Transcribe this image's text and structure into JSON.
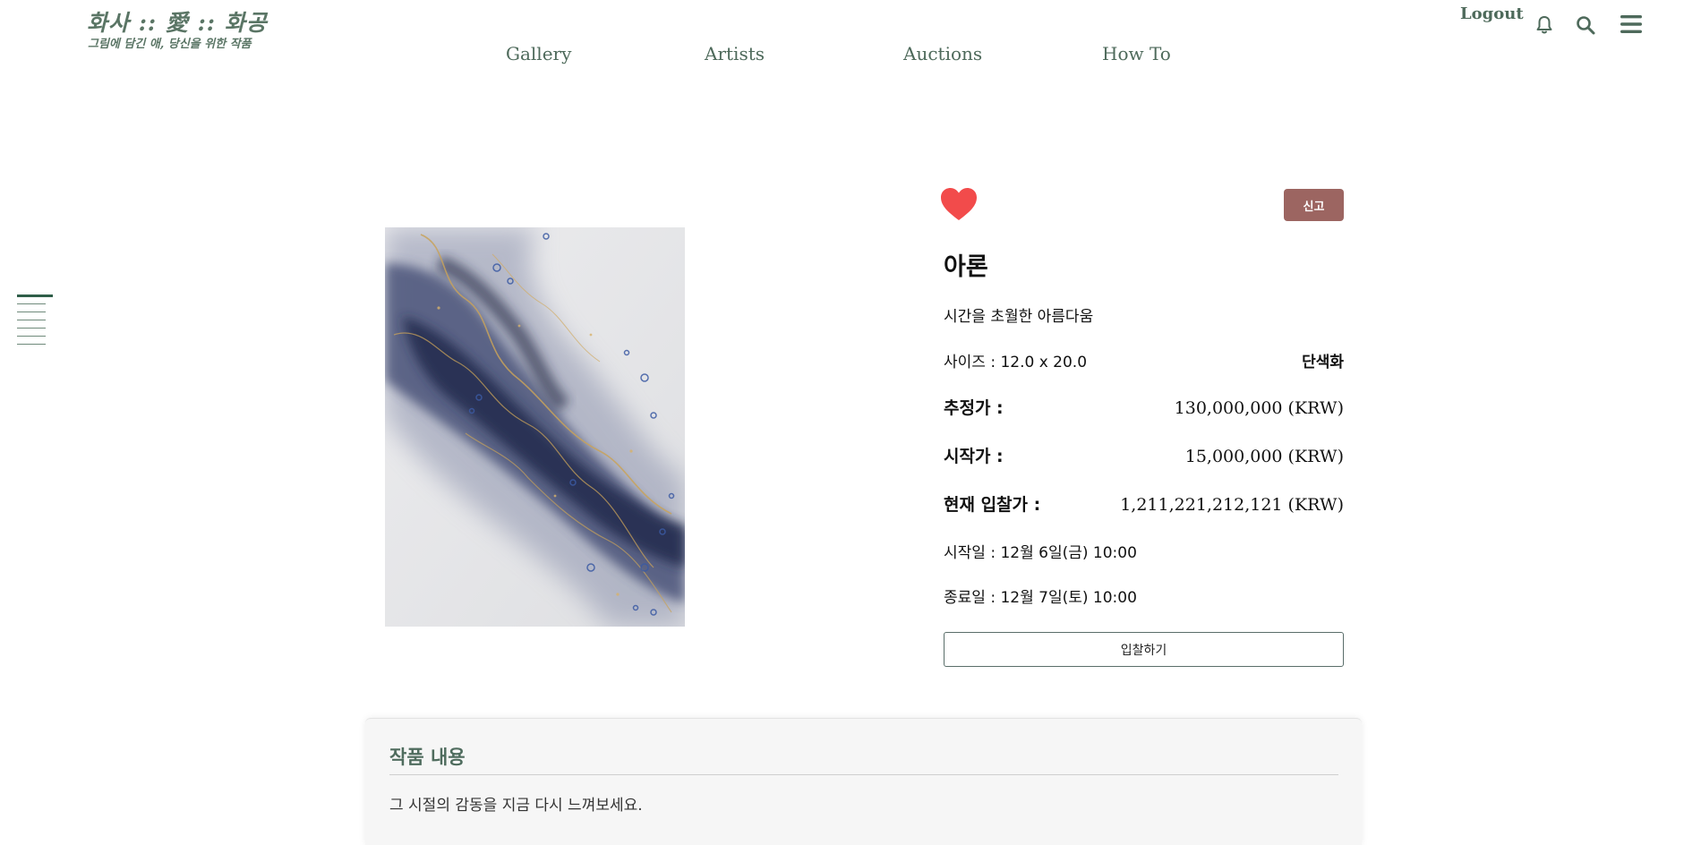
{
  "brand": {
    "title": "화사 :: 愛 :: 화공",
    "subtitle": "그림에 담긴 애, 당신을 위한 작품"
  },
  "nav": {
    "items": [
      {
        "label": "Gallery"
      },
      {
        "label": "Artists"
      },
      {
        "label": "Auctions"
      },
      {
        "label": "How To"
      }
    ]
  },
  "header": {
    "logout_label": "Logout",
    "icons": [
      "bell-icon",
      "search-icon",
      "menu-icon"
    ]
  },
  "artwork": {
    "liked": true,
    "report_label": "신고",
    "title": "아론",
    "subtitle": "시간을 초월한 아름다움",
    "size_label": "사이즈 : 12.0 x 20.0",
    "type": "단색화",
    "estimate_label": "추정가 :",
    "estimate_value": "130,000,000 (KRW)",
    "start_price_label": "시작가 :",
    "start_price_value": "15,000,000 (KRW)",
    "current_bid_label": "현재 입찰가 :",
    "current_bid_value": "1,211,221,212,121 (KRW)",
    "start_date": "시작일 : 12월 6일(금) 10:00",
    "end_date": "종료일 : 12월 7일(토) 10:00",
    "bid_button_label": "입찰하기"
  },
  "description": {
    "heading": "작품 내용",
    "body": "그 시절의 감동을 지금 다시 느껴보세요."
  },
  "colors": {
    "brand_green": "#4e6a5b",
    "report_button": "#9c6561",
    "heart": "#f24b4b"
  }
}
